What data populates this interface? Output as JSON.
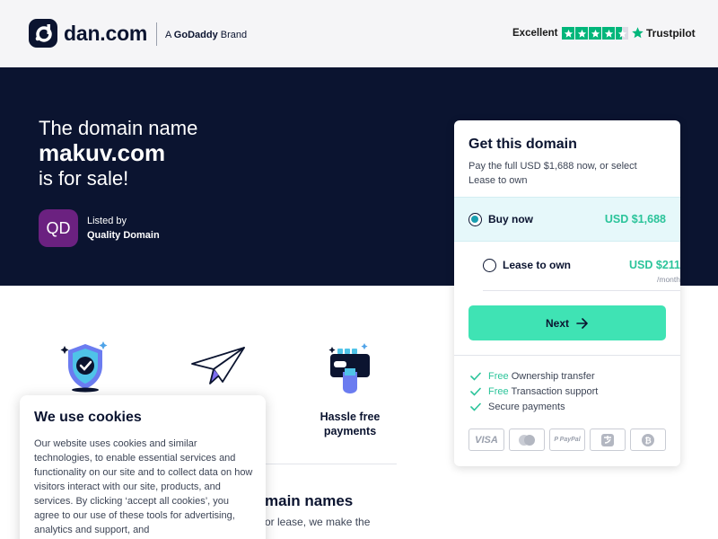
{
  "header": {
    "logo_text": "dan.com",
    "brand_prefix": "A",
    "brand_name": "GoDaddy",
    "brand_suffix": "Brand",
    "trustpilot": {
      "rating_label": "Excellent",
      "stars": 4.5,
      "name": "Trustpilot"
    }
  },
  "hero": {
    "line1": "The domain name",
    "domain": "makuv.com",
    "line3": "is for sale!",
    "seller": {
      "badge": "QD",
      "listed_by_label": "Listed by",
      "name": "Quality Domain"
    }
  },
  "features": [
    {
      "label": "",
      "icon": "shield-check-icon"
    },
    {
      "label": "",
      "icon": "paper-plane-icon"
    },
    {
      "label": "Hassle free payments",
      "icon": "payment-card-icon"
    }
  ],
  "section": {
    "title": "main names",
    "text": "or lease, we make the"
  },
  "card": {
    "title": "Get this domain",
    "subtitle": "Pay the full USD $1,688 now, or select Lease to own",
    "options": [
      {
        "label": "Buy now",
        "price": "USD $1,688",
        "selected": true
      },
      {
        "label": "Lease to own",
        "price": "USD $211",
        "unit": "/month",
        "selected": false
      }
    ],
    "next_label": "Next",
    "benefits": [
      {
        "highlight": "Free",
        "text": "Ownership transfer"
      },
      {
        "highlight": "Free",
        "text": "Transaction support"
      },
      {
        "highlight": "",
        "text": "Secure payments"
      }
    ],
    "payment_methods": [
      "VISA",
      "mastercard",
      "PayPal",
      "alipay",
      "bitcoin"
    ],
    "payment_labels": {
      "visa": "VISA",
      "paypal": "P PayPal"
    }
  },
  "cookies": {
    "title": "We use cookies",
    "text": "Our website uses cookies and similar technologies, to enable essential services and functionality on our site and to collect data on how visitors interact with our site, products, and services. By clicking ‘accept all cookies’, you agree to our use of these tools for advertising, analytics and support, and"
  },
  "colors": {
    "navy": "#0b1430",
    "accent_green": "#3fe3b4",
    "price_green": "#2bc49a",
    "trustpilot_green": "#00b67a",
    "seller_purple": "#6b2180"
  }
}
